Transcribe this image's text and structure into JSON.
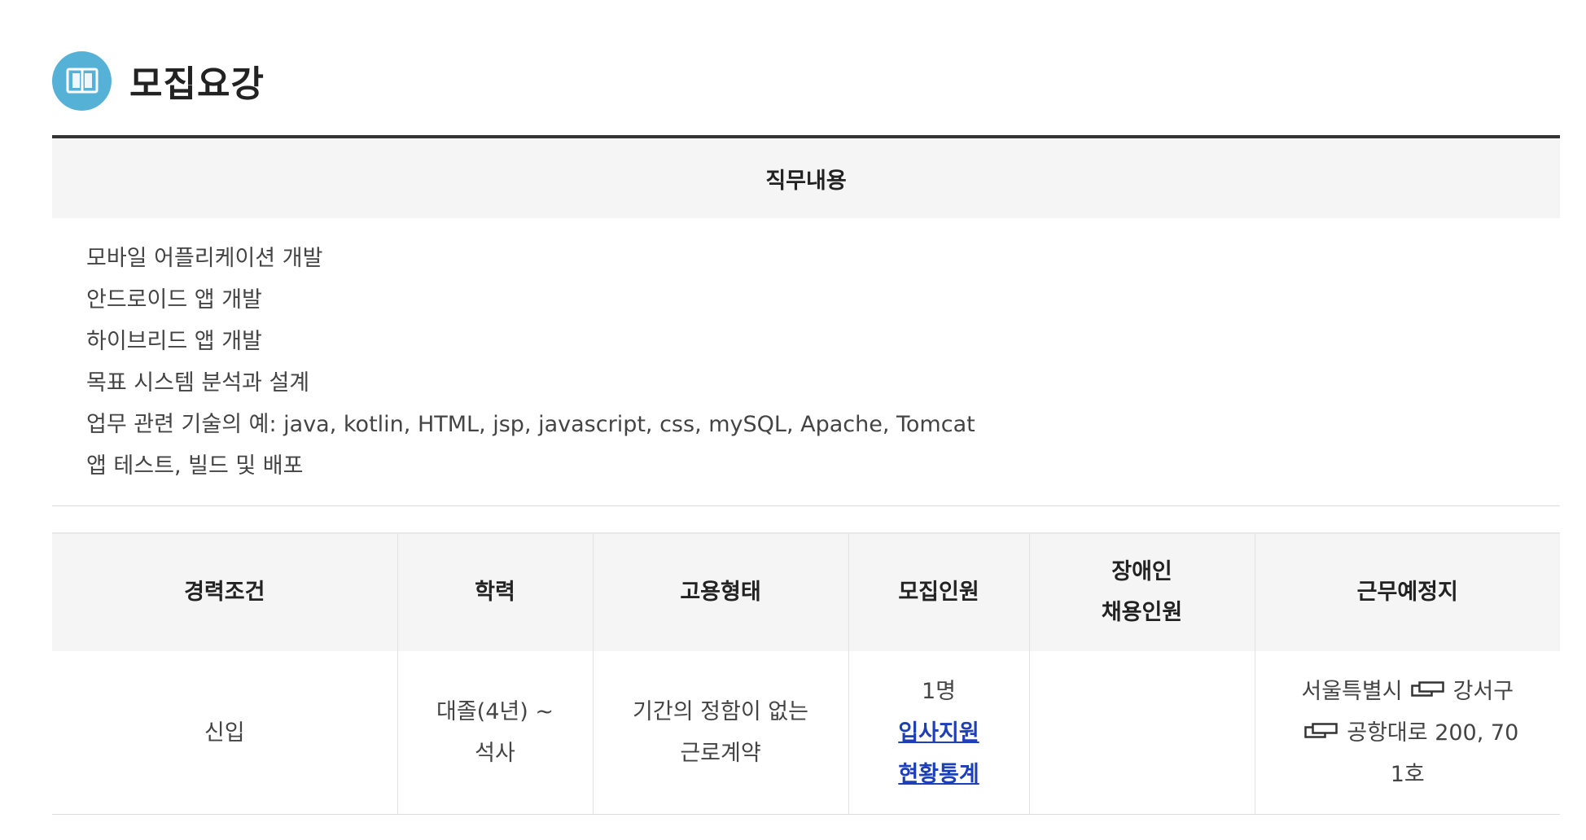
{
  "section": {
    "title": "모집요강",
    "icon": "book-icon"
  },
  "duty": {
    "header": "직무내용",
    "lines": [
      "모바일 어플리케이션 개발",
      "안드로이드 앱 개발",
      "하이브리드 앱 개발",
      "목표 시스템 분석과 설계",
      "업무 관련 기술의 예: java, kotlin, HTML, jsp, javascript, css, mySQL, Apache, Tomcat",
      "앱 테스트, 빌드 및 배포"
    ]
  },
  "conditions": {
    "headers": {
      "career": "경력조건",
      "education": "학력",
      "employment": "고용형태",
      "headcount": "모집인원",
      "disabled_line1": "장애인",
      "disabled_line2": "채용인원",
      "location": "근무예정지"
    },
    "row": {
      "career": "신입",
      "education_line1": "대졸(4년) ~",
      "education_line2": "석사",
      "employment_line1": "기간의 정함이 없는",
      "employment_line2": "근로계약",
      "headcount": "1명",
      "stats_link_line1": "입사지원",
      "stats_link_line2": "현황통계",
      "disabled": "",
      "location_city": "서울특별시",
      "location_district": "강서구",
      "location_address": "공항대로 200, 70",
      "location_unit": "1호",
      "location_icon": "map-window-icon"
    }
  },
  "colors": {
    "accent": "#56b1d6",
    "link": "#1d3fb8",
    "header_bg": "#f5f5f5"
  }
}
